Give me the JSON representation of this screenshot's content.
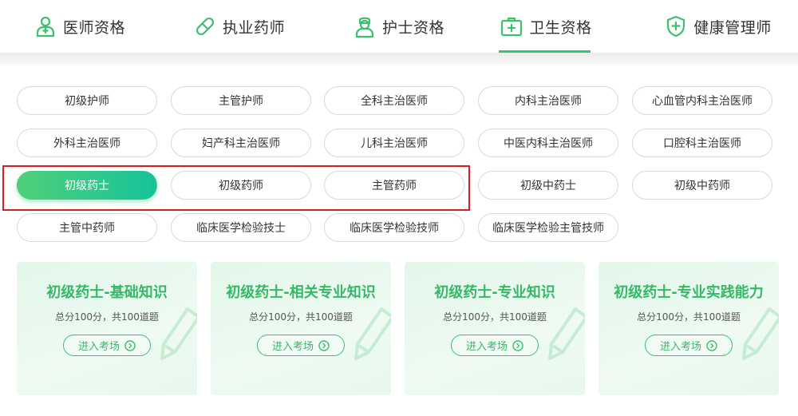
{
  "tabs": [
    {
      "label": "医师资格",
      "icon": "doctor-icon",
      "active": false
    },
    {
      "label": "执业药师",
      "icon": "pill-capsule-icon",
      "active": false
    },
    {
      "label": "护士资格",
      "icon": "nurse-icon",
      "active": false
    },
    {
      "label": "卫生资格",
      "icon": "medical-kit-icon",
      "active": true
    },
    {
      "label": "健康管理师",
      "icon": "shield-plus-icon",
      "active": false
    }
  ],
  "categories": [
    {
      "label": "初级护师",
      "active": false
    },
    {
      "label": "主管护师",
      "active": false
    },
    {
      "label": "全科主治医师",
      "active": false
    },
    {
      "label": "内科主治医师",
      "active": false
    },
    {
      "label": "心血管内科主治医师",
      "active": false
    },
    {
      "label": "外科主治医师",
      "active": false
    },
    {
      "label": "妇产科主治医师",
      "active": false
    },
    {
      "label": "儿科主治医师",
      "active": false
    },
    {
      "label": "中医内科主治医师",
      "active": false
    },
    {
      "label": "口腔科主治医师",
      "active": false
    },
    {
      "label": "初级药士",
      "active": true
    },
    {
      "label": "初级药师",
      "active": false
    },
    {
      "label": "主管药师",
      "active": false
    },
    {
      "label": "初级中药士",
      "active": false
    },
    {
      "label": "初级中药师",
      "active": false
    },
    {
      "label": "主管中药师",
      "active": false
    },
    {
      "label": "临床医学检验技士",
      "active": false
    },
    {
      "label": "临床医学检验技师",
      "active": false
    },
    {
      "label": "临床医学检验主管技师",
      "active": false
    }
  ],
  "exams": [
    {
      "title": "初级药士-基础知识",
      "subtitle": "总分100分，共100道题",
      "button": "进入考场"
    },
    {
      "title": "初级药士-相关专业知识",
      "subtitle": "总分100分，共100道题",
      "button": "进入考场"
    },
    {
      "title": "初级药士-专业知识",
      "subtitle": "总分100分，共100道题",
      "button": "进入考场"
    },
    {
      "title": "初级药士-专业实践能力",
      "subtitle": "总分100分，共100道题",
      "button": "进入考场"
    }
  ],
  "colors": {
    "accent": "#35c27a",
    "highlight": "#d81e1e",
    "card_bg": "#e8f8ee"
  }
}
